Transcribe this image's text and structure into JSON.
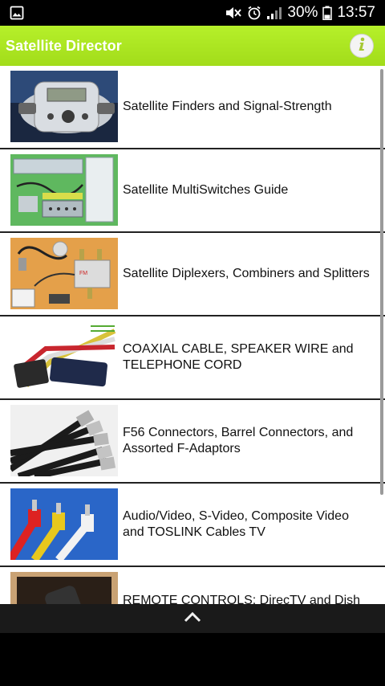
{
  "status_bar": {
    "battery_percent": "30%",
    "time": "13:57",
    "icons": [
      "image-icon",
      "mute-icon",
      "alarm-icon",
      "signal-icon",
      "battery-icon"
    ]
  },
  "app_bar": {
    "title": "Satellite Director",
    "info_icon": "info-icon",
    "background_color": "#a6e22e"
  },
  "list": {
    "items": [
      {
        "label": "Satellite Finders and Signal-Strength",
        "thumb": "satellite-finder"
      },
      {
        "label": "Satellite MultiSwitches Guide",
        "thumb": "multiswitch"
      },
      {
        "label": "Satellite Diplexers, Combiners and Splitters",
        "thumb": "diplexer"
      },
      {
        "label": "COAXIAL CABLE, SPEAKER WIRE and TELEPHONE CORD",
        "thumb": "coax-cables"
      },
      {
        "label": "F56 Connectors, Barrel Connectors, and Assorted F-Adaptors",
        "thumb": "f-connectors"
      },
      {
        "label": "Audio/Video, S-Video, Composite Video and TOSLINK Cables  TV",
        "thumb": "rca-cables"
      },
      {
        "label": "REMOTE CONTROLS: DirecTV and Dish",
        "thumb": "remote-controls"
      }
    ]
  },
  "bottom_bar": {
    "icon": "chevron-up-icon"
  }
}
